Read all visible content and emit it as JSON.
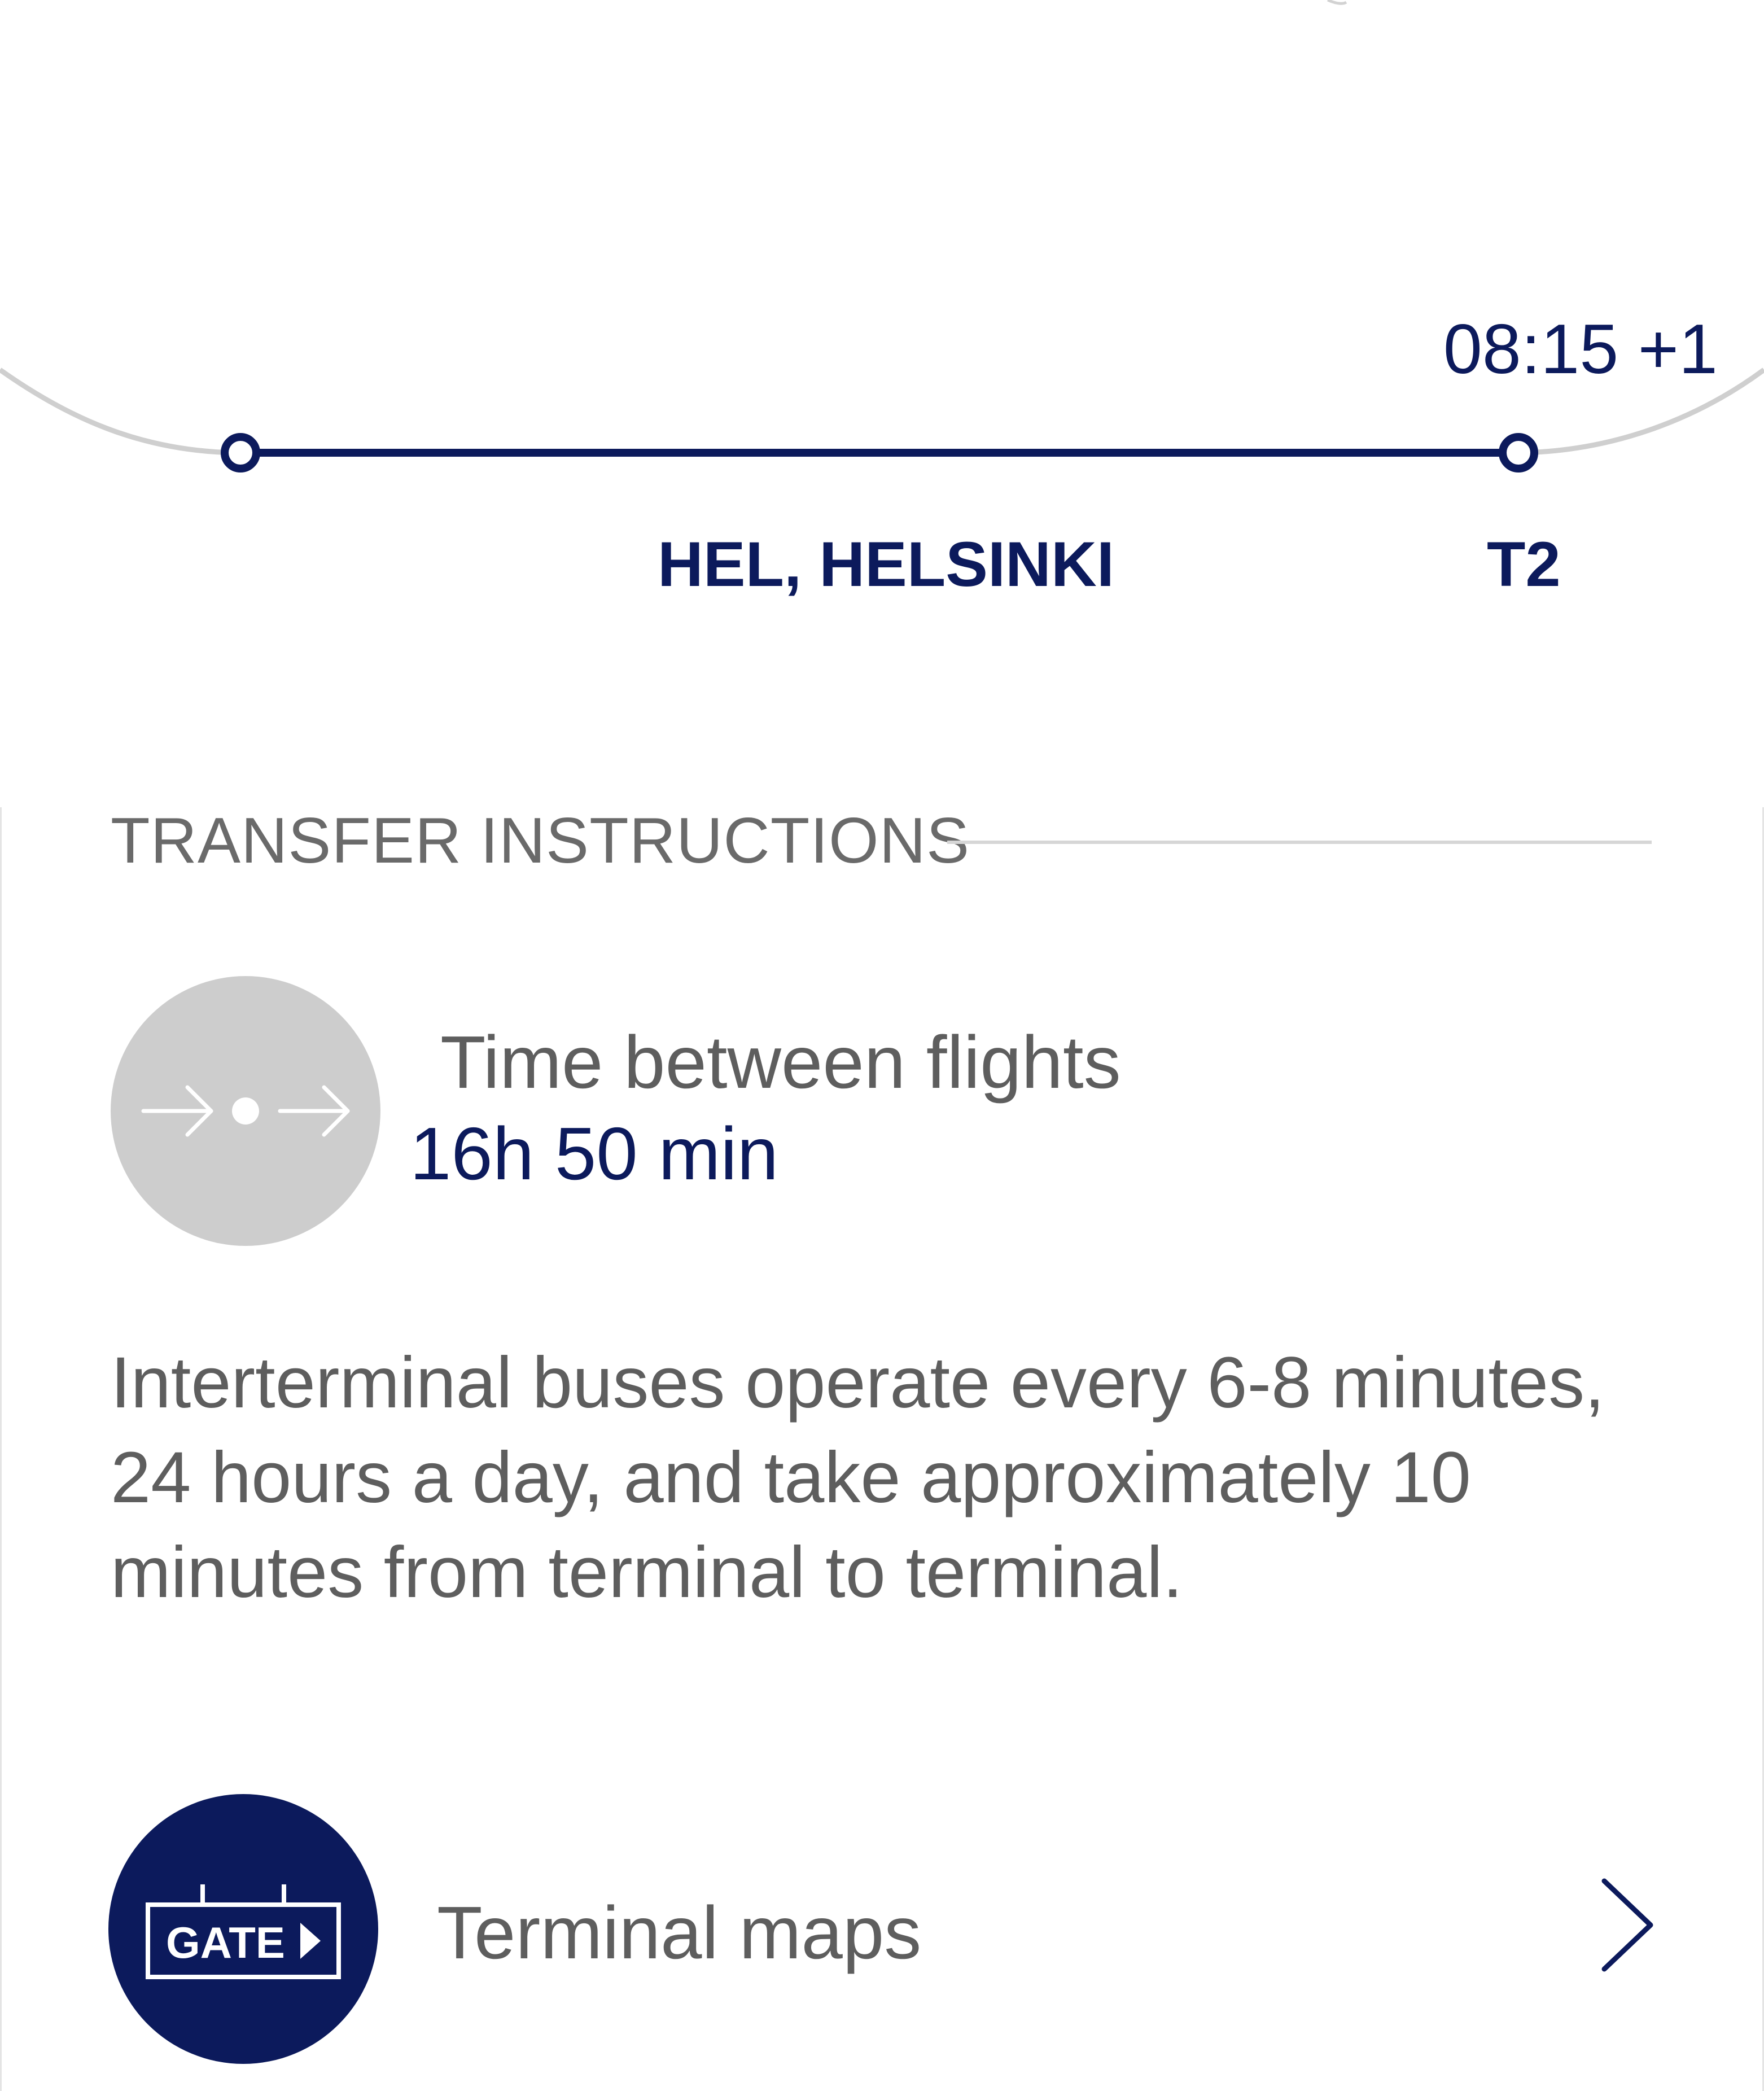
{
  "route": {
    "arrival_time": "08:15 +1",
    "airport": "HEL, HELSINKI",
    "terminal": "T2",
    "line_color": "#0c1a5c"
  },
  "transfer": {
    "section_title": "TRANSFER INSTRUCTIONS",
    "time_label": "Time between flights",
    "time_value": "16h 50 min",
    "icon": "transfer-arrows-icon",
    "info": "Interterminal buses operate every 6-8 minutes, 24 hours a day, and take approximately 10 minutes from terminal to terminal."
  },
  "terminal_maps": {
    "label": "Terminal maps",
    "icon_text": "GATE",
    "icon": "gate-sign-icon",
    "chevron": "chevron-right-icon"
  },
  "colors": {
    "brand_navy": "#0c1a5c",
    "muted_text": "#5e5e5e",
    "icon_gray": "#cdcdcd"
  }
}
